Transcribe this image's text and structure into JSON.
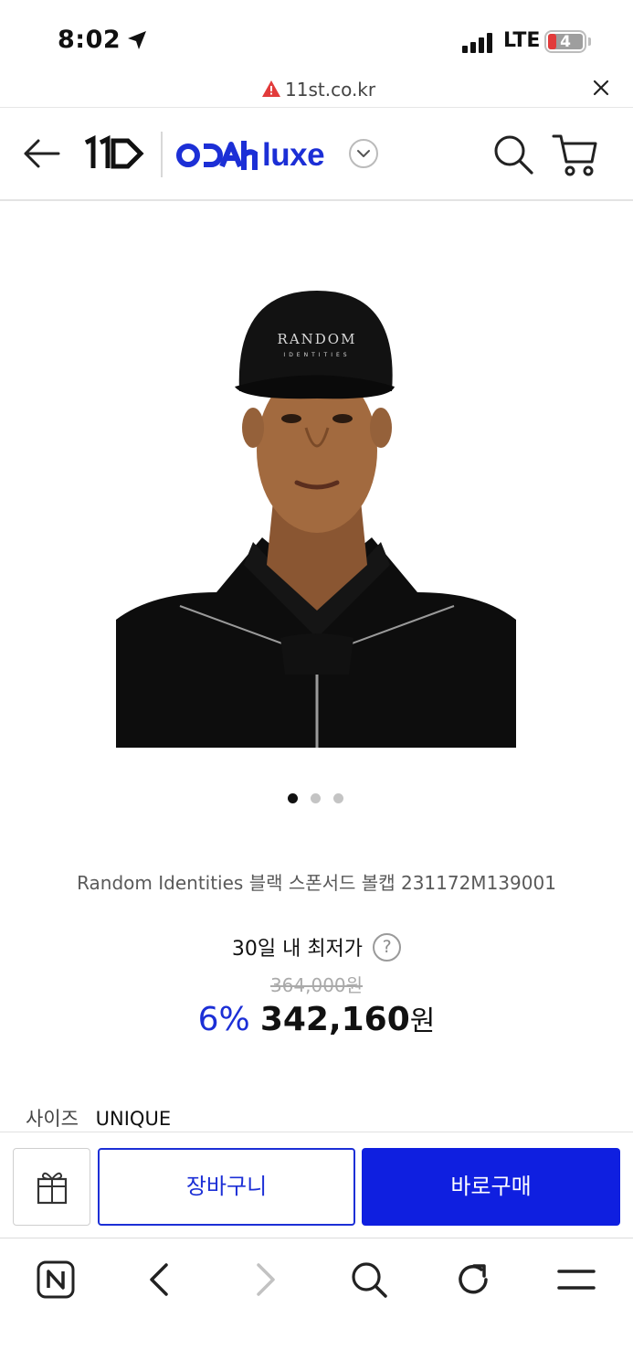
{
  "status_bar": {
    "time": "8:02",
    "network": "LTE",
    "battery": "4",
    "icons": [
      "location-arrow-icon",
      "signal-icon",
      "battery-icon"
    ]
  },
  "url_bar": {
    "domain": "11st.co.kr",
    "icons": [
      "warning-icon",
      "close-icon"
    ]
  },
  "header": {
    "logo": "11",
    "brand": "luxe",
    "brand_mark": "OOAh",
    "icons": [
      "back-arrow-icon",
      "chevron-down-icon",
      "search-icon",
      "cart-icon"
    ]
  },
  "product": {
    "image_dots": 3,
    "active_dot": 0,
    "name": "Random Identities 블랙 스폰서드 볼캡 231172M139001",
    "lowest_label": "30일 내 최저가",
    "lowest_help": "?",
    "original_price": "364,000원",
    "discount": "6%",
    "sale_price": "342,160",
    "currency": "원",
    "size_label": "사이즈",
    "size_value": "UNIQUE"
  },
  "actions": {
    "cart_label": "장바구니",
    "buy_label": "바로구매",
    "gift_icon": "gift-icon"
  },
  "browser_nav": {
    "icons": [
      "naver-icon",
      "back-icon",
      "forward-icon",
      "search-icon",
      "reload-icon",
      "menu-icon"
    ]
  },
  "colors": {
    "brand_blue": "#1c2fd6",
    "buy_blue": "#0f1fe0",
    "warning_red": "#e23b3b"
  }
}
